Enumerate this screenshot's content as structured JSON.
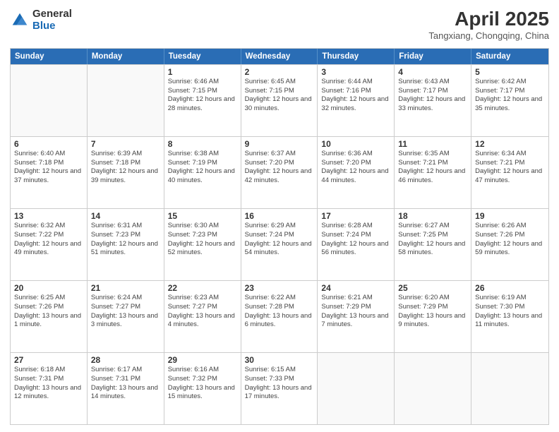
{
  "logo": {
    "general": "General",
    "blue": "Blue"
  },
  "title": "April 2025",
  "subtitle": "Tangxiang, Chongqing, China",
  "header_days": [
    "Sunday",
    "Monday",
    "Tuesday",
    "Wednesday",
    "Thursday",
    "Friday",
    "Saturday"
  ],
  "weeks": [
    [
      {
        "day": "",
        "info": ""
      },
      {
        "day": "",
        "info": ""
      },
      {
        "day": "1",
        "info": "Sunrise: 6:46 AM\nSunset: 7:15 PM\nDaylight: 12 hours and 28 minutes."
      },
      {
        "day": "2",
        "info": "Sunrise: 6:45 AM\nSunset: 7:15 PM\nDaylight: 12 hours and 30 minutes."
      },
      {
        "day": "3",
        "info": "Sunrise: 6:44 AM\nSunset: 7:16 PM\nDaylight: 12 hours and 32 minutes."
      },
      {
        "day": "4",
        "info": "Sunrise: 6:43 AM\nSunset: 7:17 PM\nDaylight: 12 hours and 33 minutes."
      },
      {
        "day": "5",
        "info": "Sunrise: 6:42 AM\nSunset: 7:17 PM\nDaylight: 12 hours and 35 minutes."
      }
    ],
    [
      {
        "day": "6",
        "info": "Sunrise: 6:40 AM\nSunset: 7:18 PM\nDaylight: 12 hours and 37 minutes."
      },
      {
        "day": "7",
        "info": "Sunrise: 6:39 AM\nSunset: 7:18 PM\nDaylight: 12 hours and 39 minutes."
      },
      {
        "day": "8",
        "info": "Sunrise: 6:38 AM\nSunset: 7:19 PM\nDaylight: 12 hours and 40 minutes."
      },
      {
        "day": "9",
        "info": "Sunrise: 6:37 AM\nSunset: 7:20 PM\nDaylight: 12 hours and 42 minutes."
      },
      {
        "day": "10",
        "info": "Sunrise: 6:36 AM\nSunset: 7:20 PM\nDaylight: 12 hours and 44 minutes."
      },
      {
        "day": "11",
        "info": "Sunrise: 6:35 AM\nSunset: 7:21 PM\nDaylight: 12 hours and 46 minutes."
      },
      {
        "day": "12",
        "info": "Sunrise: 6:34 AM\nSunset: 7:21 PM\nDaylight: 12 hours and 47 minutes."
      }
    ],
    [
      {
        "day": "13",
        "info": "Sunrise: 6:32 AM\nSunset: 7:22 PM\nDaylight: 12 hours and 49 minutes."
      },
      {
        "day": "14",
        "info": "Sunrise: 6:31 AM\nSunset: 7:23 PM\nDaylight: 12 hours and 51 minutes."
      },
      {
        "day": "15",
        "info": "Sunrise: 6:30 AM\nSunset: 7:23 PM\nDaylight: 12 hours and 52 minutes."
      },
      {
        "day": "16",
        "info": "Sunrise: 6:29 AM\nSunset: 7:24 PM\nDaylight: 12 hours and 54 minutes."
      },
      {
        "day": "17",
        "info": "Sunrise: 6:28 AM\nSunset: 7:24 PM\nDaylight: 12 hours and 56 minutes."
      },
      {
        "day": "18",
        "info": "Sunrise: 6:27 AM\nSunset: 7:25 PM\nDaylight: 12 hours and 58 minutes."
      },
      {
        "day": "19",
        "info": "Sunrise: 6:26 AM\nSunset: 7:26 PM\nDaylight: 12 hours and 59 minutes."
      }
    ],
    [
      {
        "day": "20",
        "info": "Sunrise: 6:25 AM\nSunset: 7:26 PM\nDaylight: 13 hours and 1 minute."
      },
      {
        "day": "21",
        "info": "Sunrise: 6:24 AM\nSunset: 7:27 PM\nDaylight: 13 hours and 3 minutes."
      },
      {
        "day": "22",
        "info": "Sunrise: 6:23 AM\nSunset: 7:27 PM\nDaylight: 13 hours and 4 minutes."
      },
      {
        "day": "23",
        "info": "Sunrise: 6:22 AM\nSunset: 7:28 PM\nDaylight: 13 hours and 6 minutes."
      },
      {
        "day": "24",
        "info": "Sunrise: 6:21 AM\nSunset: 7:29 PM\nDaylight: 13 hours and 7 minutes."
      },
      {
        "day": "25",
        "info": "Sunrise: 6:20 AM\nSunset: 7:29 PM\nDaylight: 13 hours and 9 minutes."
      },
      {
        "day": "26",
        "info": "Sunrise: 6:19 AM\nSunset: 7:30 PM\nDaylight: 13 hours and 11 minutes."
      }
    ],
    [
      {
        "day": "27",
        "info": "Sunrise: 6:18 AM\nSunset: 7:31 PM\nDaylight: 13 hours and 12 minutes."
      },
      {
        "day": "28",
        "info": "Sunrise: 6:17 AM\nSunset: 7:31 PM\nDaylight: 13 hours and 14 minutes."
      },
      {
        "day": "29",
        "info": "Sunrise: 6:16 AM\nSunset: 7:32 PM\nDaylight: 13 hours and 15 minutes."
      },
      {
        "day": "30",
        "info": "Sunrise: 6:15 AM\nSunset: 7:33 PM\nDaylight: 13 hours and 17 minutes."
      },
      {
        "day": "",
        "info": ""
      },
      {
        "day": "",
        "info": ""
      },
      {
        "day": "",
        "info": ""
      }
    ]
  ]
}
